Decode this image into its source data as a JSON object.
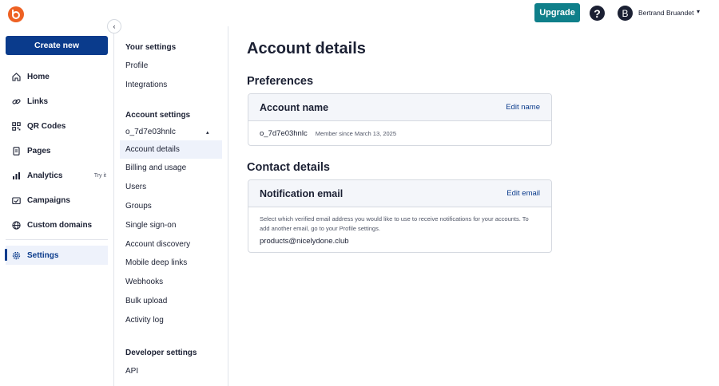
{
  "header": {
    "upgrade_label": "Upgrade",
    "help_glyph": "?",
    "avatar_initial": "B",
    "user_name": "Bertrand Bruandet",
    "caret": "▾",
    "brand_color": "#ee6123",
    "upgrade_color": "#0f7f8a"
  },
  "leftnav": {
    "collapse_glyph": "‹",
    "create_label": "Create new",
    "items": [
      {
        "label": "Home",
        "icon": "home-icon"
      },
      {
        "label": "Links",
        "icon": "link-icon"
      },
      {
        "label": "QR Codes",
        "icon": "qr-code-icon"
      },
      {
        "label": "Pages",
        "icon": "pages-icon"
      },
      {
        "label": "Analytics",
        "icon": "analytics-icon",
        "badge": "Try it"
      },
      {
        "label": "Campaigns",
        "icon": "campaigns-icon"
      },
      {
        "label": "Custom domains",
        "icon": "globe-icon"
      }
    ],
    "settings_label": "Settings"
  },
  "subnav": {
    "your_settings_heading": "Your settings",
    "your_settings": [
      "Profile",
      "Integrations"
    ],
    "account_settings_heading": "Account settings",
    "org_name": "o_7d7e03hnlc",
    "org_caret": "▴",
    "account_settings": [
      "Account details",
      "Billing and usage",
      "Users",
      "Groups",
      "Single sign-on",
      "Account discovery",
      "Mobile deep links",
      "Webhooks",
      "Bulk upload",
      "Activity log"
    ],
    "developer_settings_heading": "Developer settings",
    "developer_settings": [
      "API"
    ]
  },
  "main": {
    "page_title": "Account details",
    "preferences_title": "Preferences",
    "account_card": {
      "title": "Account name",
      "edit_label": "Edit name",
      "account_id": "o_7d7e03hnlc",
      "member_since": "Member since March 13, 2025"
    },
    "contact_title": "Contact details",
    "email_card": {
      "title": "Notification email",
      "edit_label": "Edit email",
      "description": "Select which verified email address you would like to use to receive notifications for your accounts. To add another email, go to your Profile settings.",
      "email": "products@nicelydone.club"
    }
  }
}
